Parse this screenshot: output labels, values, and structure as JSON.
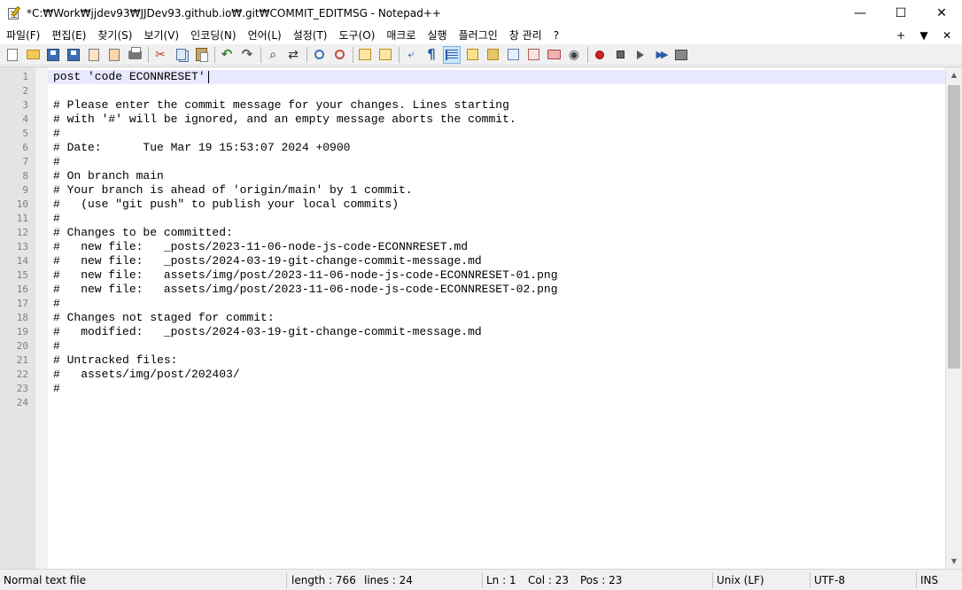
{
  "window": {
    "title": "*C:₩Work₩jjdev93₩JJDev93.github.io₩.git₩COMMIT_EDITMSG - Notepad++",
    "minimize": "—",
    "maximize": "☐",
    "close": "✕"
  },
  "menu": {
    "items": [
      "파일(F)",
      "편집(E)",
      "찾기(S)",
      "보기(V)",
      "인코딩(N)",
      "언어(L)",
      "설정(T)",
      "도구(O)",
      "매크로",
      "실행",
      "플러그인",
      "창 관리",
      "?"
    ],
    "right": [
      "+",
      "▼",
      "✕"
    ]
  },
  "toolbar": {
    "icons": [
      "new-file-icon",
      "open-file-icon",
      "save-icon",
      "save-all-icon",
      "close-icon",
      "close-all-icon",
      "print-icon",
      "cut-icon",
      "copy-icon",
      "paste-icon",
      "undo-icon",
      "redo-icon",
      "find-icon",
      "replace-icon",
      "zoom-in-icon",
      "zoom-out-icon",
      "sync-vertical-icon",
      "sync-horizontal-icon",
      "word-wrap-icon",
      "show-all-chars-icon",
      "indent-guide-icon",
      "user-lang-icon",
      "doc-map-icon",
      "doc-list-icon",
      "function-list-icon",
      "folder-workspace-icon",
      "monitoring-icon",
      "record-macro-icon",
      "stop-macro-icon",
      "play-macro-icon",
      "run-macro-multiple-icon",
      "save-macro-icon"
    ]
  },
  "editor": {
    "current_line": 1,
    "lines": [
      "post 'code ECONNRESET'",
      "",
      "# Please enter the commit message for your changes. Lines starting",
      "# with '#' will be ignored, and an empty message aborts the commit.",
      "#",
      "# Date:      Tue Mar 19 15:53:07 2024 +0900",
      "#",
      "# On branch main",
      "# Your branch is ahead of 'origin/main' by 1 commit.",
      "#   (use \"git push\" to publish your local commits)",
      "#",
      "# Changes to be committed:",
      "#   new file:   _posts/2023-11-06-node-js-code-ECONNRESET.md",
      "#   new file:   _posts/2024-03-19-git-change-commit-message.md",
      "#   new file:   assets/img/post/2023-11-06-node-js-code-ECONNRESET-01.png",
      "#   new file:   assets/img/post/2023-11-06-node-js-code-ECONNRESET-02.png",
      "#",
      "# Changes not staged for commit:",
      "#   modified:   _posts/2024-03-19-git-change-commit-message.md",
      "#",
      "# Untracked files:",
      "#   assets/img/post/202403/",
      "#",
      ""
    ]
  },
  "status": {
    "file_type": "Normal text file",
    "length": "length : 766",
    "lines": "lines : 24",
    "ln": "Ln : 1",
    "col": "Col : 23",
    "pos": "Pos : 23",
    "eol": "Unix (LF)",
    "encoding": "UTF-8",
    "mode": "INS"
  }
}
